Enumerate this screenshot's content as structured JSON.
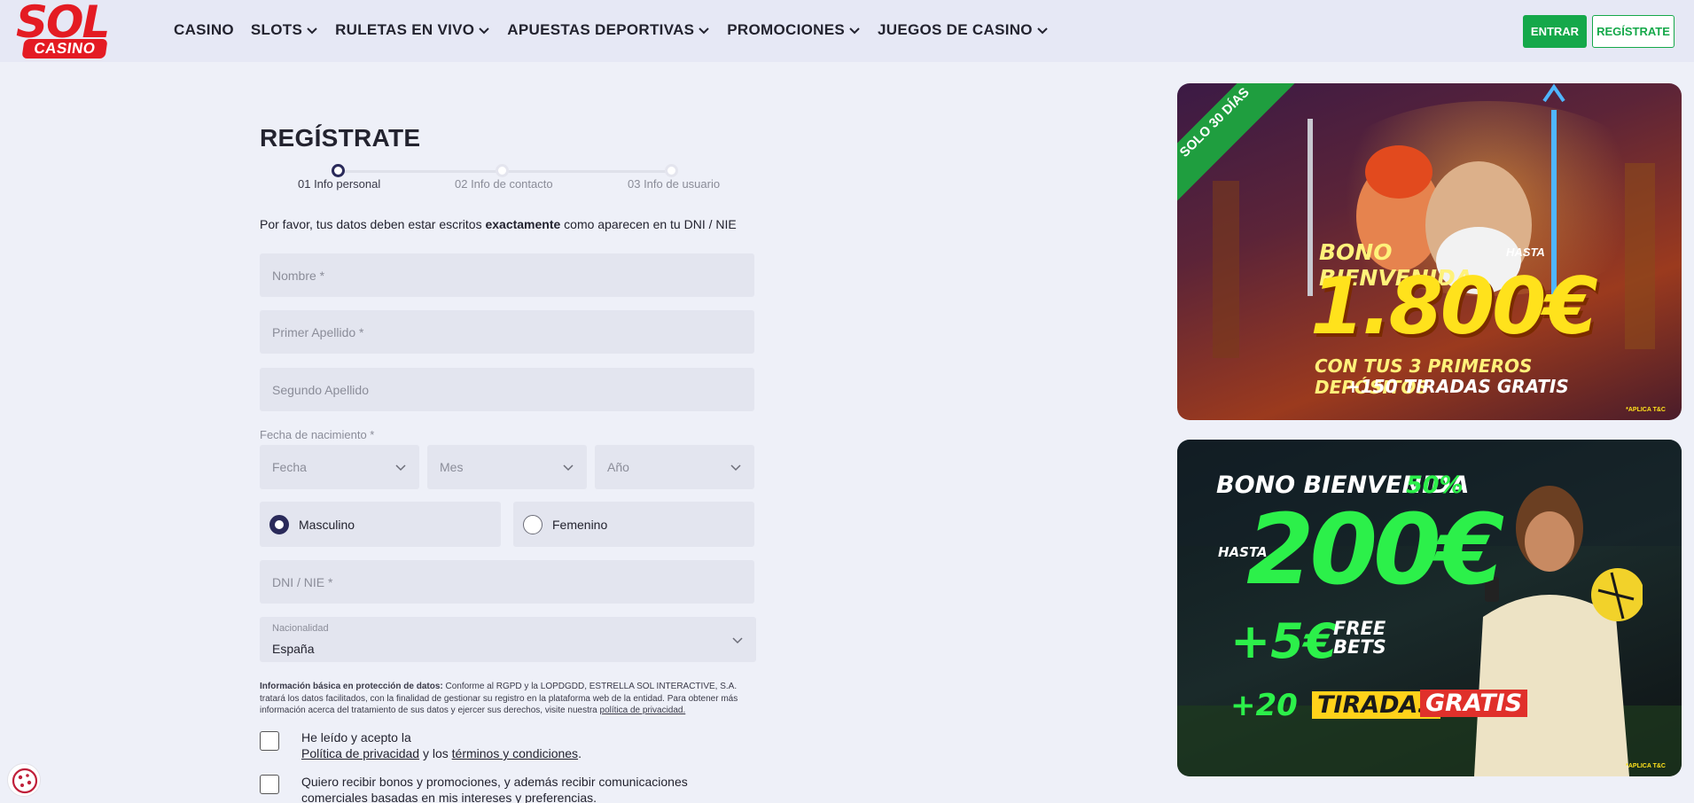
{
  "header": {
    "logo_top": "SOL",
    "logo_bottom": "CASINO",
    "nav": [
      {
        "label": "CASINO",
        "has_dropdown": false
      },
      {
        "label": "SLOTS",
        "has_dropdown": true
      },
      {
        "label": "RULETAS EN VIVO",
        "has_dropdown": true
      },
      {
        "label": "APUESTAS DEPORTIVAS",
        "has_dropdown": true
      },
      {
        "label": "PROMOCIONES",
        "has_dropdown": true
      },
      {
        "label": "JUEGOS DE CASINO",
        "has_dropdown": true
      }
    ],
    "login_label": "ENTRAR",
    "register_label": "REGÍSTRATE"
  },
  "form": {
    "title": "REGÍSTRATE",
    "steps": [
      "01 Info personal",
      "02 Info de contacto",
      "03 Info de usuario"
    ],
    "active_step": 1,
    "intro_pre": "Por favor, tus datos deben estar escritos ",
    "intro_bold": "exactamente",
    "intro_post": " como aparecen en tu DNI / NIE",
    "nombre_placeholder": "Nombre *",
    "apellido1_placeholder": "Primer Apellido *",
    "apellido2_placeholder": "Segundo Apellido",
    "birth_label": "Fecha de nacimiento *",
    "day_placeholder": "Fecha",
    "month_placeholder": "Mes",
    "year_placeholder": "Año",
    "gender_male": "Masculino",
    "gender_female": "Femenino",
    "gender_selected": "Masculino",
    "dni_placeholder": "DNI / NIE *",
    "nationality_label": "Nacionalidad",
    "nationality_value": "España",
    "legal_bold": "Información básica en protección de datos:",
    "legal_text": " Conforme al RGPD y la LOPDGDD, ESTRELLA SOL INTERACTIVE, S.A. tratará los datos facilitados, con la finalidad de gestionar su registro en la plataforma web de la entidad. Para obtener más información acerca del tratamiento de sus datos y ejercer sus derechos, visite nuestra ",
    "legal_link": "política de privacidad.",
    "check1_pre": "He leído y acepto la",
    "check1_link1": "Política de privacidad",
    "check1_mid": " y los ",
    "check1_link2": "términos y condiciones",
    "check1_post": ".",
    "check2_text": "Quiero recibir bonos y promociones, y además recibir comunicaciones comerciales basadas en mis intereses y preferencias."
  },
  "banner1": {
    "ribbon": "SOLO 30 DÍAS",
    "bono": "BONO BIENVENIDA",
    "hasta": "HASTA",
    "amount": "1.800€",
    "con": "CON TUS 3 PRIMEROS DEPÓSITOS",
    "tiradas": "+150 TIRADAS GRATIS",
    "aplica": "*APLICA T&C"
  },
  "banner2": {
    "bono": "BONO BIENVENIDA",
    "pct": "50%",
    "hasta": "HASTA",
    "amount": "200€",
    "plus5": "+5€",
    "free": "FREE",
    "bets": "BETS",
    "plus20": "+20",
    "tiradas": "TIRADAS",
    "gratis": "GRATIS",
    "aplica": "*APLICA T&C"
  },
  "colors": {
    "brand_red": "#e41b23",
    "cta_green": "#15a84a",
    "step_active": "#2a2a5a",
    "promo_green": "#2cf04a",
    "promo_yellow": "#ffe21c"
  },
  "icons": {
    "chevron": "chevron-down-icon",
    "cookie": "cookie-icon"
  }
}
